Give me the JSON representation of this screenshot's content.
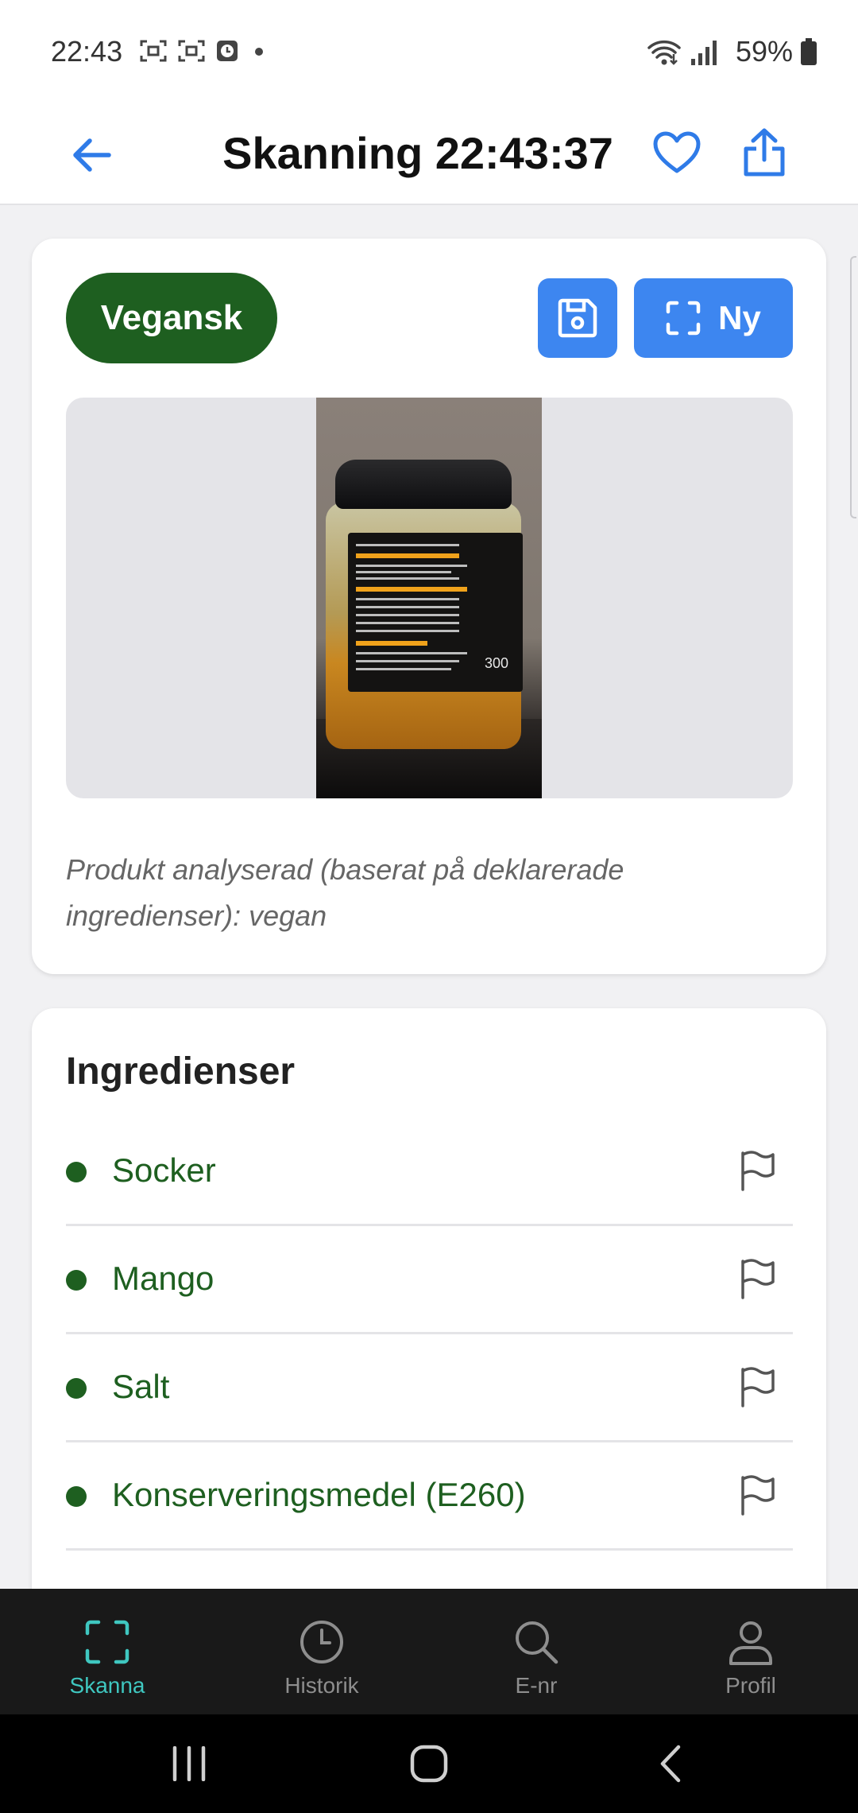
{
  "status_bar": {
    "time": "22:43",
    "battery": "59%",
    "icons_left": [
      "screenshot-icon",
      "screenshot-icon",
      "clock-app-icon",
      "dot-icon"
    ],
    "icons_right": [
      "wifi-icon",
      "signal-icon",
      "battery-icon"
    ]
  },
  "header": {
    "title": "Skanning 22:43:37",
    "back_icon": "arrow-left-icon",
    "favorite_icon": "heart-icon",
    "share_icon": "share-icon"
  },
  "result_card": {
    "badge": "Vegansk",
    "save_icon": "floppy-icon",
    "new_button_label": "Ny",
    "new_button_icon": "scan-frame-icon",
    "photo_side_text": "300",
    "analysis_text": "Produkt analyserad (baserat på deklarerade ingredienser): vegan"
  },
  "ingredients": {
    "title": "Ingredienser",
    "items": [
      {
        "label": "Socker"
      },
      {
        "label": "Mango"
      },
      {
        "label": "Salt"
      },
      {
        "label": "Konserveringsmedel (E260)"
      }
    ]
  },
  "bottom_nav": {
    "items": [
      {
        "label": "Skanna",
        "icon": "scan-icon",
        "active": true
      },
      {
        "label": "Historik",
        "icon": "clock-icon",
        "active": false
      },
      {
        "label": "E-nr",
        "icon": "search-icon",
        "active": false
      },
      {
        "label": "Profil",
        "icon": "user-icon",
        "active": false
      }
    ]
  },
  "colors": {
    "accent_blue": "#3d86f0",
    "vegan_green": "#1e5f20",
    "nav_active": "#3fc7c0",
    "nav_background": "#191919"
  }
}
